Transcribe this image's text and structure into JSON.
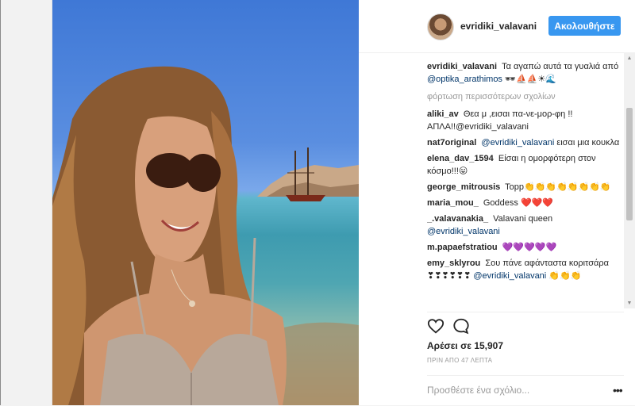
{
  "post": {
    "username": "evridiki_valavani",
    "follow_label": "Ακολουθήστε"
  },
  "caption": {
    "user": "evridiki_valavani",
    "text": "Τα αγαπώ αυτά τα γυαλιά από",
    "mention": "@optika_arathimos",
    "emoji": "🕶⛵⛵☀🌊"
  },
  "load_more": "φόρτωση περισσότερων σχολίων",
  "comments": [
    {
      "user": "aliki_av",
      "text": "Θεα μ ,εισαι πα-νε-μορ-φη !! ΑΠΛΑ!!@evridiki_valavani",
      "mention": ""
    },
    {
      "user": "nat7original",
      "text": "",
      "mention": "@evridiki_valavani",
      "after": " εισαι μια κουκλα"
    },
    {
      "user": "elena_dav_1594",
      "text": "Είσαι η ομορφότερη στον κόσμο!!!😛",
      "mention": ""
    },
    {
      "user": "george_mitrousis",
      "text": "Topp👏👏👏👏👏👏👏👏",
      "mention": ""
    },
    {
      "user": "maria_mou_",
      "text": "Goddess ❤️❤️❤️",
      "mention": ""
    },
    {
      "user": "_.valavanakia_",
      "text": "Valavani queen",
      "mention": "@evridiki_valavani"
    },
    {
      "user": "m.papaefstratiou",
      "text": "💜💜💜💜💜",
      "mention": ""
    },
    {
      "user": "emy_sklyrou",
      "text": "Σου πάνε αφάνταστα κοριτσάρα ❣❣❣❣❣❣",
      "mention": "@evridiki_valavani",
      "after": " 👏👏👏"
    }
  ],
  "icons": {
    "like": "heart-outline-icon",
    "comment": "speech-bubble-icon",
    "more": "horizontal-ellipsis-icon"
  },
  "likes_text": "Αρέσει σε 15,907",
  "timestamp": "ΠΡΙΝ ΑΠΟ 47 ΛΕΠΤΑ",
  "add_comment_placeholder": "Προσθέστε ένα σχόλιο...",
  "more_label": "•••",
  "colors": {
    "follow_button": "#3897f0",
    "mention": "#003569"
  }
}
